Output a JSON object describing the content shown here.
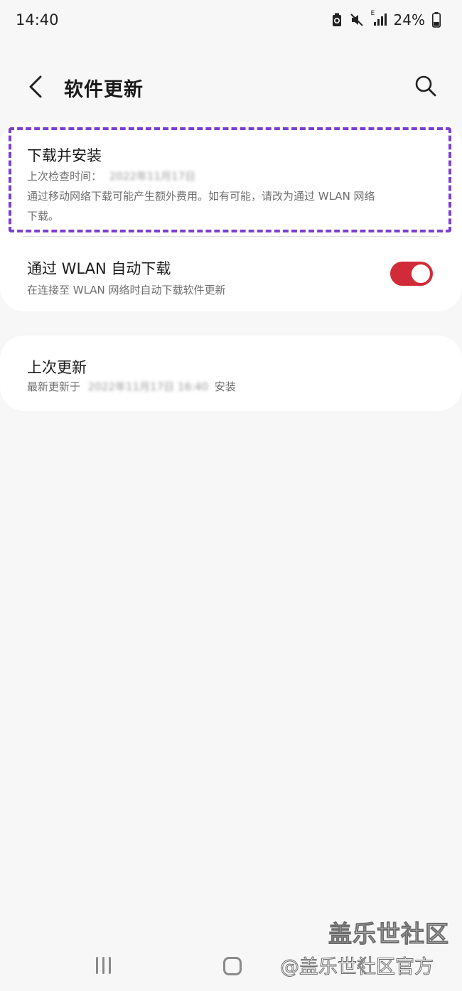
{
  "status_bar": {
    "time": "14:40",
    "network_label": "E",
    "battery_percent": "24%",
    "icons": [
      "battery-saver-icon",
      "mute-icon",
      "signal-icon",
      "battery-icon"
    ]
  },
  "header": {
    "title": "软件更新",
    "back_icon": "chevron-left-icon",
    "search_icon": "search-icon"
  },
  "settings": {
    "download": {
      "title": "下载并安装",
      "last_check_label": "上次检查时间：",
      "last_check_value": "2022年11月17日",
      "note_line1": "通过移动网络下载可能产生额外费用。如有可能，请改为通过 WLAN 网络",
      "note_line2": "下载。"
    },
    "auto_download": {
      "title": "通过 WLAN 自动下载",
      "subtitle": "在连接至 WLAN 网络时自动下载软件更新",
      "enabled": true
    }
  },
  "last_update": {
    "title": "上次更新",
    "prefix": "最新更新于",
    "value": "2022年11月17日 16:40",
    "suffix": "安装"
  },
  "watermark": {
    "line1": "盖乐世社区",
    "line2": "@盖乐世社区官方"
  },
  "colors": {
    "accent_toggle": "#d12a38",
    "highlight_border": "#7b3fcf"
  }
}
